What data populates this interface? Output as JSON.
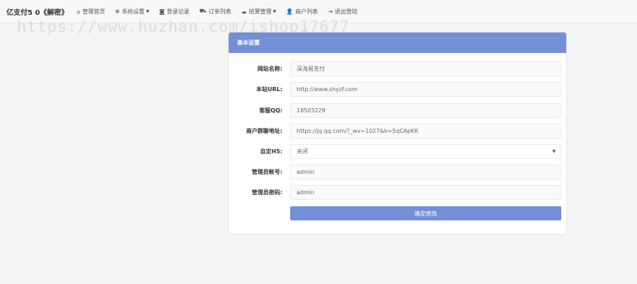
{
  "navbar": {
    "brand": "亿支付5 0《解密》",
    "items": [
      {
        "label": "管理首页",
        "icon": "home-icon"
      },
      {
        "label": "系统设置",
        "icon": "gear-icon",
        "dropdown": true
      },
      {
        "label": "登录记录",
        "icon": "camera-icon"
      },
      {
        "label": "订单列表",
        "icon": "cart-icon"
      },
      {
        "label": "结算管理",
        "icon": "cloud-icon",
        "dropdown": true
      },
      {
        "label": "商户列表",
        "icon": "user-icon"
      },
      {
        "label": "退出登陆",
        "icon": "logout-icon"
      }
    ]
  },
  "watermark": "https://www.huzhan.com/ishop17677",
  "panel": {
    "title": "基本设置",
    "fields": [
      {
        "label": "网站名称:",
        "value": "深海易支付"
      },
      {
        "label": "本站URL:",
        "value": "http://www.shyzf.com"
      },
      {
        "label": "客服QQ:",
        "value": "18503229"
      },
      {
        "label": "商户群聊地址:",
        "value": "https://jq.qq.com/?_wv=1027&k=5qCApKK"
      },
      {
        "label": "自定H5:",
        "value": "关闭",
        "type": "select"
      },
      {
        "label": "管理员帐号:",
        "value": "admin"
      },
      {
        "label": "管理员密码:",
        "value": "admin"
      }
    ],
    "submit_label": "确定修改"
  }
}
